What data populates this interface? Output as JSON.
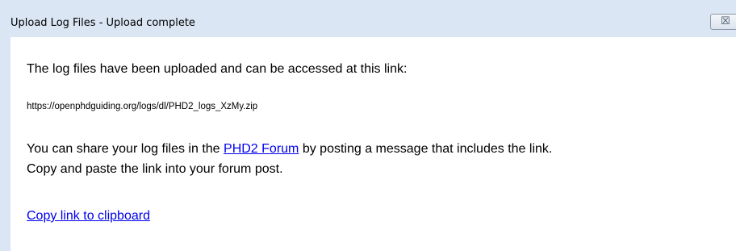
{
  "dialog": {
    "title": "Upload Log Files - Upload complete",
    "close_glyph": "☒"
  },
  "content": {
    "intro_text": "The log files have been uploaded and can be accessed at this link:",
    "url": "https://openphdguiding.org/logs/dl/PHD2_logs_XzMy.zip",
    "share_before": "You can share your log files in the ",
    "forum_link": "PHD2 Forum",
    "share_after": " by posting a message that includes the link.",
    "copy_paste_text": "Copy and paste the link into your forum post.",
    "copy_link_label": "Copy link to clipboard"
  },
  "icons": {
    "close": "close-icon"
  },
  "colors": {
    "link": "#0000ee",
    "titlebar": "#dbe6f4"
  }
}
